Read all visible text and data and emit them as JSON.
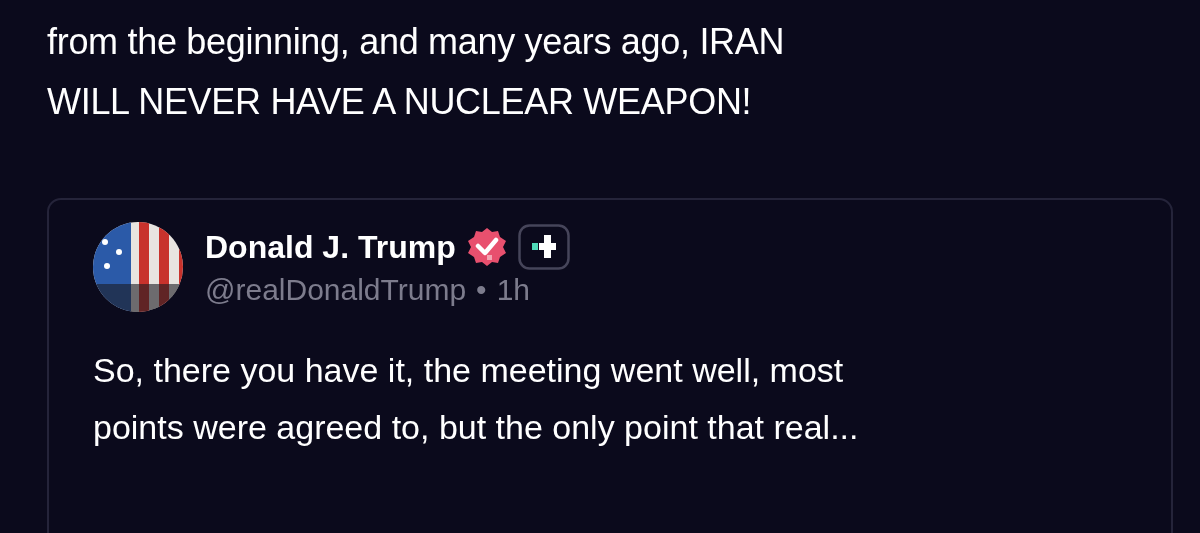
{
  "post": {
    "text_lines": [
      "from the beginning, and many years ago, IRAN",
      "WILL NEVER HAVE A NUCLEAR WEAPON!"
    ]
  },
  "quoted_post": {
    "author": "Donald J. Trump",
    "verified": true,
    "handle": "@realDonaldTrump",
    "separator": "•",
    "time": "1h",
    "text_lines": [
      "So, there you have it, the meeting went well, most",
      "points were agreed to, but the only point that real..."
    ]
  }
}
